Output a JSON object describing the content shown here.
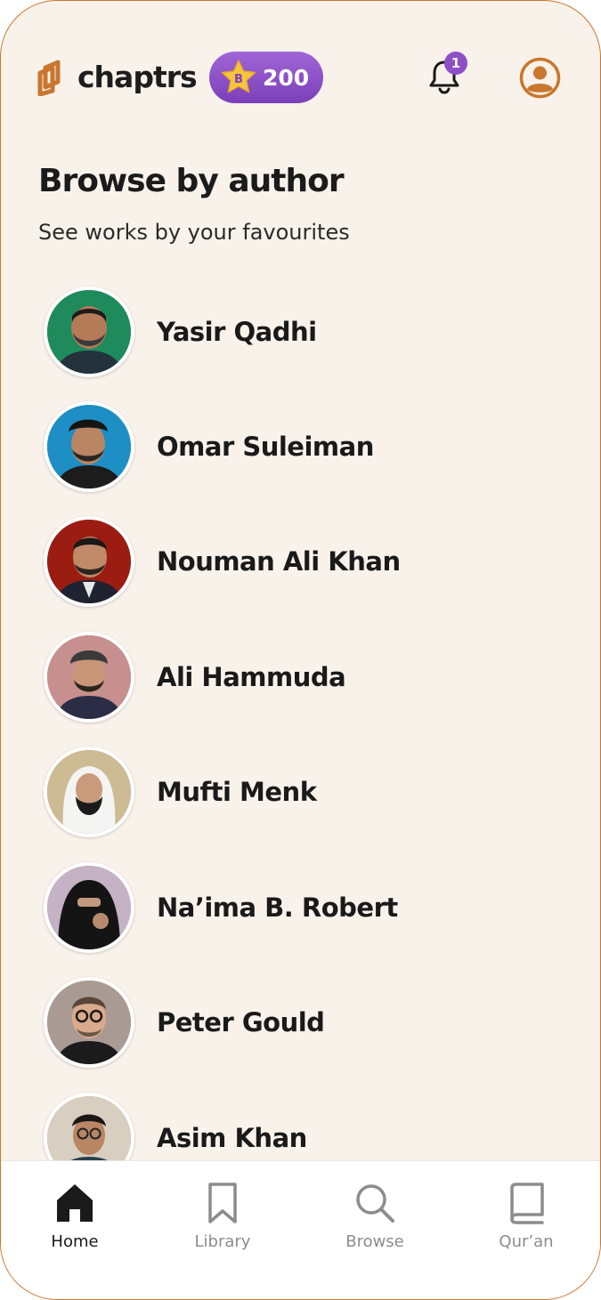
{
  "header": {
    "brand": "chaptrs",
    "points_badge_letter": "B",
    "points": "200",
    "notification_count": "1",
    "colors": {
      "brand_orange": "#c9762e",
      "badge_purple": "#8e4fc6",
      "background": "#f8f2ea"
    },
    "icons": [
      "chaptrs-logo-icon",
      "star-badge-icon",
      "bell-icon",
      "profile-icon"
    ]
  },
  "page": {
    "title": "Browse by author",
    "subtitle": "See works by your favourites"
  },
  "authors": [
    {
      "name": "Yasir Qadhi",
      "avatar_bg": "#1f8a5b"
    },
    {
      "name": "Omar Suleiman",
      "avatar_bg": "#1d8fc4"
    },
    {
      "name": "Nouman Ali Khan",
      "avatar_bg": "#9b1d12"
    },
    {
      "name": "Ali Hammuda",
      "avatar_bg": "#c88f8f"
    },
    {
      "name": "Mufti Menk",
      "avatar_bg": "#cdbb93"
    },
    {
      "name": "Na’ima B. Robert",
      "avatar_bg": "#c5b2c4"
    },
    {
      "name": "Peter Gould",
      "avatar_bg": "#a99a93"
    },
    {
      "name": "Asim Khan",
      "avatar_bg": "#d8cfc1"
    }
  ],
  "bottom_nav": {
    "items": [
      {
        "label": "Home",
        "icon": "home-icon",
        "active": true
      },
      {
        "label": "Library",
        "icon": "bookmark-icon",
        "active": false
      },
      {
        "label": "Browse",
        "icon": "search-icon",
        "active": false
      },
      {
        "label": "Qur’an",
        "icon": "book-icon",
        "active": false
      }
    ]
  }
}
